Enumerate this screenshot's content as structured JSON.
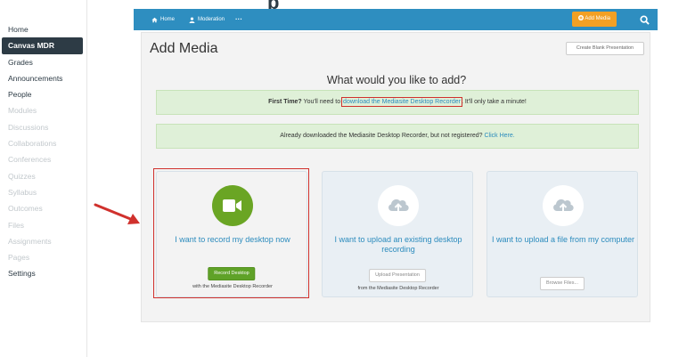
{
  "top_fragment": "p",
  "sidebar": {
    "items": [
      {
        "label": "Home",
        "state": "normal"
      },
      {
        "label": "Canvas MDR",
        "state": "active"
      },
      {
        "label": "Grades",
        "state": "normal"
      },
      {
        "label": "Announcements",
        "state": "normal"
      },
      {
        "label": "People",
        "state": "normal"
      },
      {
        "label": "Modules",
        "state": "disabled"
      },
      {
        "label": "Discussions",
        "state": "disabled"
      },
      {
        "label": "Collaborations",
        "state": "disabled"
      },
      {
        "label": "Conferences",
        "state": "disabled"
      },
      {
        "label": "Quizzes",
        "state": "disabled"
      },
      {
        "label": "Syllabus",
        "state": "disabled"
      },
      {
        "label": "Outcomes",
        "state": "disabled"
      },
      {
        "label": "Files",
        "state": "disabled"
      },
      {
        "label": "Assignments",
        "state": "disabled"
      },
      {
        "label": "Pages",
        "state": "disabled"
      },
      {
        "label": "Settings",
        "state": "normal"
      }
    ]
  },
  "topbar": {
    "home_label": "Home",
    "moderation_label": "Moderation",
    "more_label": "···",
    "add_media_label": "Add Media",
    "search_icon": "search-icon"
  },
  "main": {
    "title": "Add Media",
    "blank_button": "Create Blank Presentation",
    "question": "What would you like to add?",
    "banner1": {
      "lead": "First Time?",
      "text_before": " You'll need to ",
      "link": "download the Mediasite Desktop Recorder",
      "text_after": ". It'll only take a minute!"
    },
    "banner2": {
      "text": "Already downloaded the Mediasite Desktop Recorder, but not registered? ",
      "link": "Click Here."
    },
    "cards": [
      {
        "icon": "video-camera-icon",
        "text": "I want to record my desktop now",
        "button": "Record Desktop",
        "note": "with the Mediasite Desktop Recorder"
      },
      {
        "icon": "cloud-upload-icon",
        "text": "I want to upload an existing desktop recording",
        "button": "Upload Presentation",
        "note": "from the Mediasite Desktop Recorder"
      },
      {
        "icon": "cloud-upload-icon",
        "text": "I want to upload a file from my computer",
        "button": "Browse Files..."
      }
    ]
  },
  "colors": {
    "topbar": "#2e8ec0",
    "add_media": "#f2a024",
    "banner_bg": "#dff0d8",
    "record_green": "#6aa524",
    "link_blue": "#2b8bbd",
    "annotation_red": "#d0312d"
  }
}
